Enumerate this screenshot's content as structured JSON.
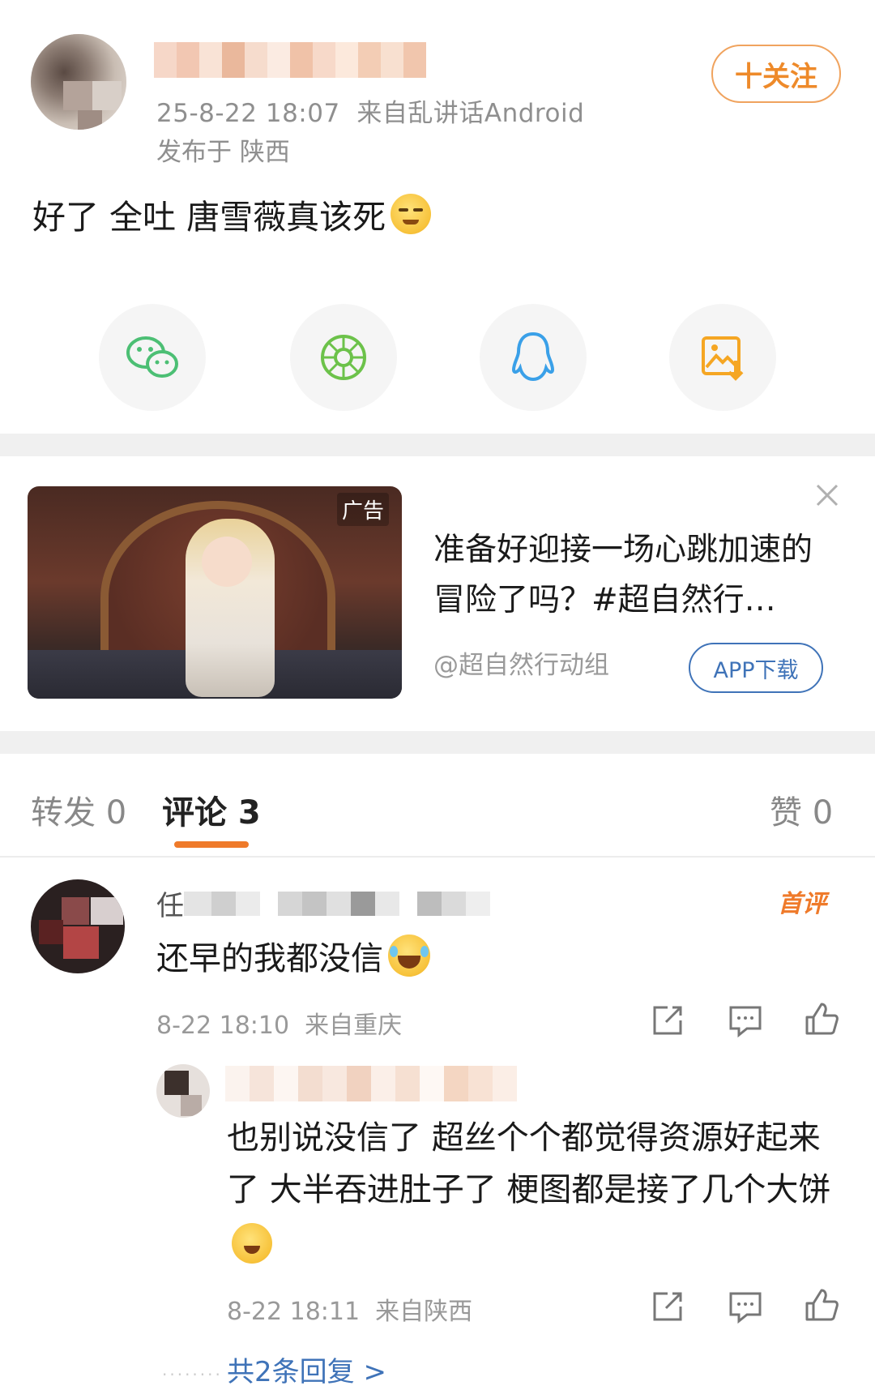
{
  "post": {
    "timestamp": "25-8-22 18:07",
    "source": "来自乱讲话Android",
    "location": "发布于 陕西",
    "follow_label": "十关注",
    "text": "好了 全吐 唐雪薇真该死"
  },
  "share": [
    {
      "name": "wechat-icon"
    },
    {
      "name": "moments-icon"
    },
    {
      "name": "qq-icon"
    },
    {
      "name": "save-image-icon"
    }
  ],
  "ad": {
    "tag": "广告",
    "title": "准备好迎接一场心跳加速的冒险了吗？#超自然行…",
    "source": "@超自然行动组",
    "button": "APP下载"
  },
  "tabs": {
    "repost": "转发 0",
    "comment": "评论 3",
    "like": "赞 0"
  },
  "comments": [
    {
      "name_prefix": "任",
      "badge": "首评",
      "text": "还早的我都没信",
      "time": "8-22 18:10",
      "from": "来自重庆"
    }
  ],
  "reply": {
    "text": "也别说没信了 超丝个个都觉得资源好起来了 大半吞进肚子了 梗图都是接了几个大饼",
    "time": "8-22 18:11",
    "from": "来自陕西",
    "more": "共2条回复 >"
  },
  "colors": {
    "accent": "#ef7a2a",
    "link": "#3f73b8",
    "follow": "#ee8a2a"
  }
}
